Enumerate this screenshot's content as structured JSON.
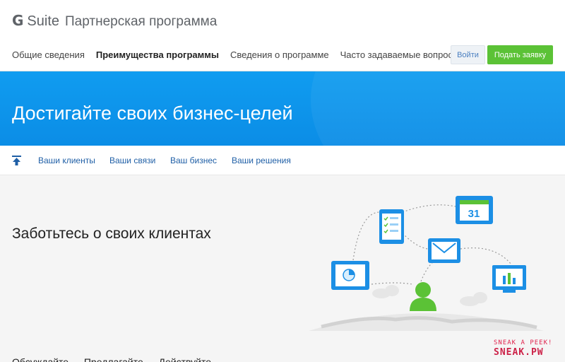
{
  "header": {
    "brand_g": "G",
    "brand_suite": "Suite",
    "brand_program": "Партнерская программа",
    "nav": [
      {
        "label": "Общие сведения",
        "active": false
      },
      {
        "label": "Преимущества программы",
        "active": true
      },
      {
        "label": "Сведения о программе",
        "active": false
      },
      {
        "label": "Часто задаваемые вопросы",
        "active": false
      }
    ],
    "login_label": "Войти",
    "apply_label": "Подать заявку",
    "apply_color": "#5bc236"
  },
  "hero": {
    "title": "Достигайте своих бизнес-целей",
    "color": "#0b95ee"
  },
  "subnav": {
    "up_icon": "arrow-up-icon",
    "links": [
      "Ваши клиенты",
      "Ваши связи",
      "Ваш бизнес",
      "Ваши решения"
    ]
  },
  "main": {
    "section_title": "Заботьтесь о своих клиентах",
    "calendar_day": "31",
    "bottom_text_partial": "Обсуждайте … Предлагайте … Действуйте"
  },
  "watermark": {
    "line1": "SNEAK A PEEK!",
    "line2": "SNEAK.PW"
  }
}
